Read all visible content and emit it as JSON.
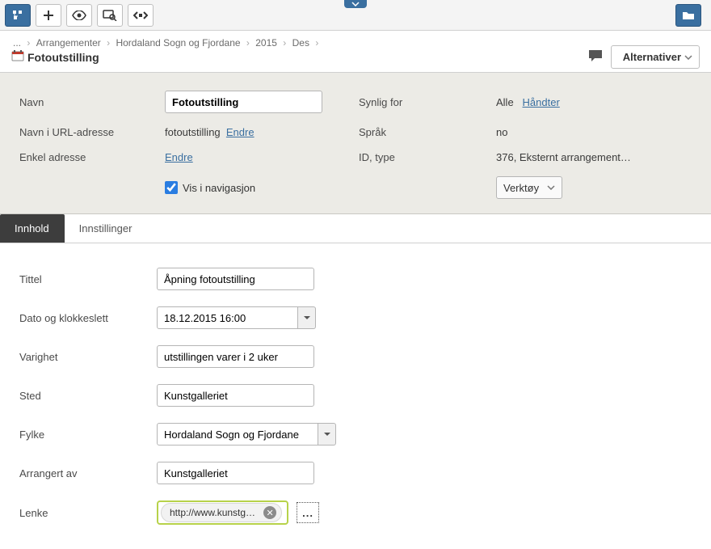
{
  "breadcrumbs": {
    "root": "...",
    "items": [
      "Arrangementer",
      "Hordaland Sogn og Fjordane",
      "2015",
      "Des"
    ]
  },
  "page_title": "Fotoutstilling",
  "alternatives_label": "Alternativer",
  "card": {
    "labels": {
      "name": "Navn",
      "url_name": "Navn i URL-adresse",
      "simple_addr": "Enkel adresse",
      "visible_for": "Synlig for",
      "language": "Språk",
      "id_type": "ID, type",
      "vis_nav": "Vis i navigasjon"
    },
    "name_value": "Fotoutstilling",
    "url_name_value": "fotoutstilling",
    "endre": "Endre",
    "visible_for_value": "Alle",
    "handle": "Håndter",
    "language_value": "no",
    "id_type_value": "376, Eksternt arrangement…",
    "tools_label": "Verktøy"
  },
  "tabs": {
    "content": "Innhold",
    "settings": "Innstillinger"
  },
  "form": {
    "labels": {
      "title": "Tittel",
      "datetime": "Dato og klokkeslett",
      "duration": "Varighet",
      "place": "Sted",
      "county": "Fylke",
      "arranged_by": "Arrangert av",
      "link": "Lenke"
    },
    "title_value": "Åpning fotoutstilling",
    "datetime_value": "18.12.2015 16:00",
    "duration_value": "utstillingen varer i 2 uker",
    "place_value": "Kunstgalleriet",
    "county_value": "Hordaland Sogn og Fjordane",
    "arranged_by_value": "Kunstgalleriet",
    "link_value": "http://www.kunstg…",
    "dots": "..."
  }
}
